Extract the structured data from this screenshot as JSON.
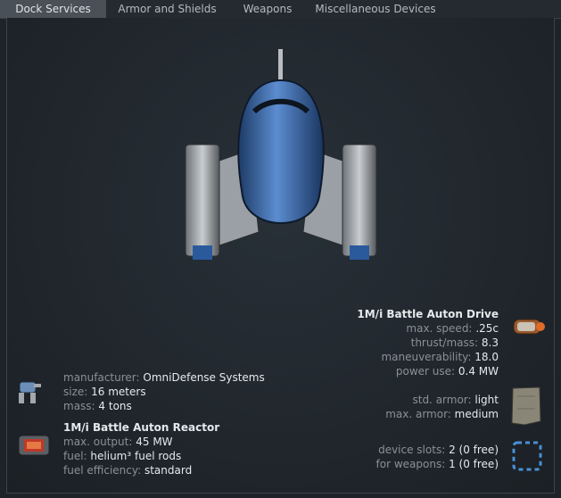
{
  "tabs": [
    {
      "label": "Dock Services",
      "active": true
    },
    {
      "label": "Armor and Shields",
      "active": false
    },
    {
      "label": "Weapons",
      "active": false
    },
    {
      "label": "Miscellaneous Devices",
      "active": false
    }
  ],
  "hull": {
    "manufacturer_label": "manufacturer:",
    "manufacturer": "OmniDefense Systems",
    "size_label": "size:",
    "size": "16 meters",
    "mass_label": "mass:",
    "mass": "4 tons"
  },
  "reactor": {
    "name": "1M/i Battle Auton Reactor",
    "max_output_label": "max. output:",
    "max_output": "45 MW",
    "fuel_label": "fuel:",
    "fuel": "helium³ fuel rods",
    "fuel_efficiency_label": "fuel efficiency:",
    "fuel_efficiency": "standard"
  },
  "drive": {
    "name": "1M/i Battle Auton Drive",
    "max_speed_label": "max. speed:",
    "max_speed": ".25c",
    "thrust_mass_label": "thrust/mass:",
    "thrust_mass": "8.3",
    "maneuverability_label": "maneuverability:",
    "maneuverability": "18.0",
    "power_use_label": "power use:",
    "power_use": "0.4 MW"
  },
  "armor": {
    "std_armor_label": "std. armor:",
    "std_armor": "light",
    "max_armor_label": "max. armor:",
    "max_armor": "medium"
  },
  "slots": {
    "device_slots_label": "device slots:",
    "device_slots": "2 (0 free)",
    "for_weapons_label": "for weapons:",
    "for_weapons": "1 (0 free)"
  },
  "colors": {
    "background": "#1e2328",
    "active_tab": "#4a5057",
    "label": "#8a9099",
    "value": "#e6e9ec",
    "slot_accent": "#4a8fd6"
  },
  "icons": {
    "ship": "battle-auton-ship",
    "hull": "auton-hull-icon",
    "reactor": "reactor-icon",
    "drive": "drive-icon",
    "armor": "armor-plate-icon",
    "slots": "device-slots-icon"
  }
}
